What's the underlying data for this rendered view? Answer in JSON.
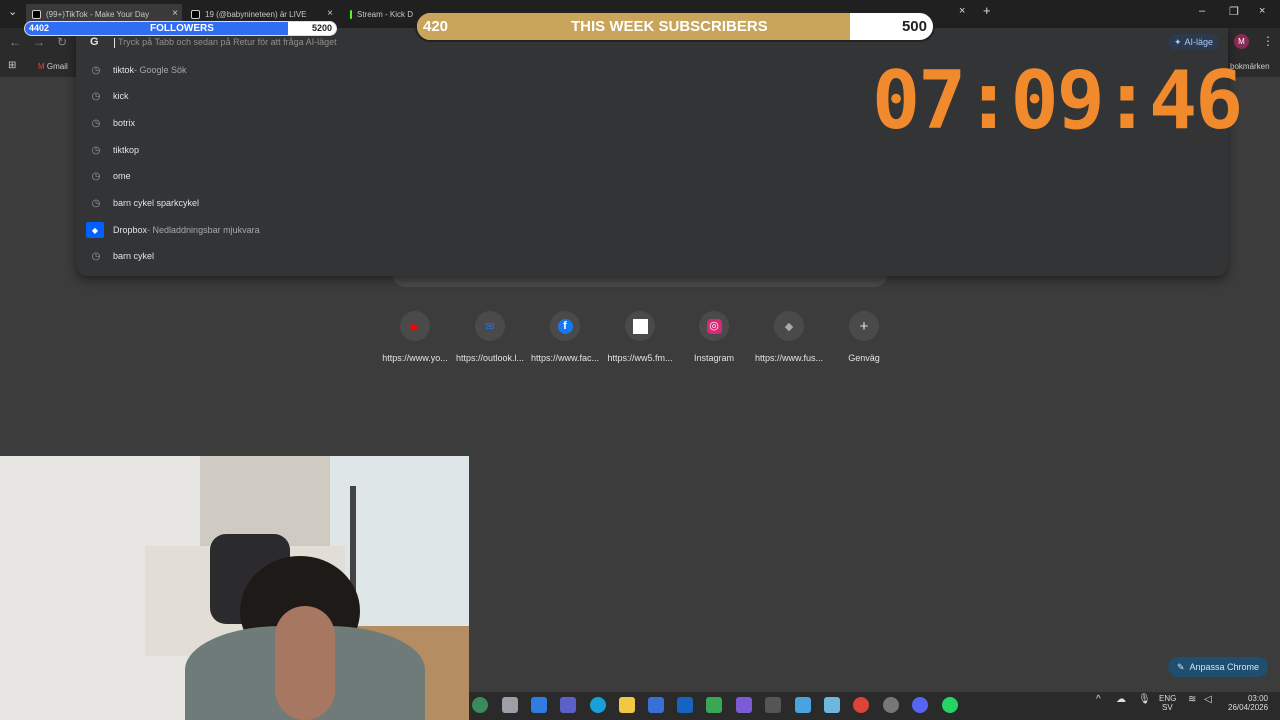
{
  "tabs": [
    {
      "title": "(99+)TikTok - Make Your Day",
      "fav": "#ffffff"
    },
    {
      "title": "19 (@babynineteen) är LIVE",
      "fav": "#ffffff"
    },
    {
      "title": "Stream - Kick D",
      "fav": "#53fc18"
    }
  ],
  "omnibox": {
    "placeholder": "Tryck på Tabb och sedan på Retur för att fråga AI-läget",
    "g_label": "G"
  },
  "suggestions": [
    {
      "text": "tiktok",
      "dim": " - Google Sök"
    },
    {
      "text": "kick",
      "dim": ""
    },
    {
      "text": "botrix",
      "dim": ""
    },
    {
      "text": "tiktkop",
      "dim": ""
    },
    {
      "text": "ome",
      "dim": ""
    },
    {
      "text": "barn cykel sparkcykel",
      "dim": ""
    },
    {
      "text": "Dropbox",
      "dim": " - Nedladdningsbar mjukvara"
    },
    {
      "text": "barn cykel",
      "dim": ""
    }
  ],
  "ai_mode": "AI-läge",
  "avatar": "M",
  "bookmark": "Gmail",
  "bookmark_right": "bokmärken",
  "shortcuts": [
    {
      "label": "https://www.yo...",
      "icon": "youtube-icon",
      "color": "#ff0000",
      "glyph": "▶"
    },
    {
      "label": "https://outlook.l...",
      "icon": "outlook-icon",
      "color": "#1a73e8",
      "glyph": "✉"
    },
    {
      "label": "https://www.fac...",
      "icon": "facebook-icon",
      "color": "#1877f2",
      "glyph": "f"
    },
    {
      "label": "https://ww5.fm...",
      "icon": "blank-page-icon",
      "color": "#ffffff",
      "glyph": ""
    },
    {
      "label": "Instagram",
      "icon": "instagram-icon",
      "color": "#d62976",
      "glyph": "◎"
    },
    {
      "label": "https://www.fus...",
      "icon": "fusion-icon",
      "color": "#888888",
      "glyph": "◆"
    },
    {
      "label": "Genväg",
      "icon": "plus-icon",
      "color": "#4a4a4a",
      "glyph": "+"
    }
  ],
  "followers": {
    "current": "4402",
    "label": "FOLLOWERS",
    "goal": "5200",
    "progress": 0.846
  },
  "subscribers": {
    "current": "420",
    "label": "THIS WEEK SUBSCRIBERS",
    "goal": "500",
    "progress": 0.84
  },
  "timer": "07:09:46",
  "customize": "Anpassa Chrome",
  "tray": {
    "lang1": "ENG",
    "lang2": "SV",
    "time": "03:00",
    "date": "26/04/2026"
  },
  "colors": {
    "accent_orange": "#f08a2c",
    "followers_blue": "#2f6df5",
    "subs_gold": "#c9a55b"
  }
}
